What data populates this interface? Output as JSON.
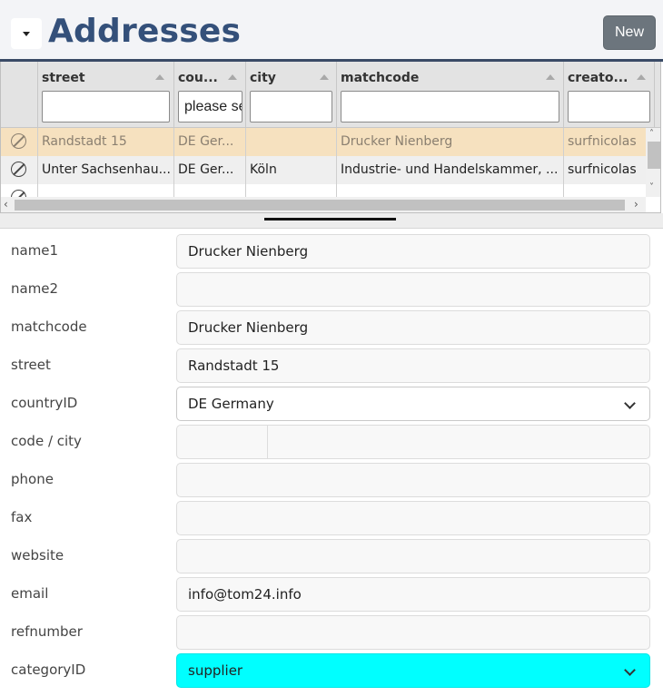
{
  "header": {
    "title": "Addresses",
    "new_label": "New"
  },
  "grid": {
    "columns": [
      {
        "title": "street",
        "filter": ""
      },
      {
        "title": "cou...",
        "filter": "please se"
      },
      {
        "title": "city",
        "filter": ""
      },
      {
        "title": "matchcode",
        "filter": ""
      },
      {
        "title": "creato...",
        "filter": ""
      }
    ],
    "rows": [
      {
        "street": "Randstadt 15",
        "country": "DE Ger...",
        "city": "",
        "matchcode": "Drucker Nienberg",
        "creator": "surfnicolas"
      },
      {
        "street": "Unter Sachsenhau...",
        "country": "DE Ger...",
        "city": "Köln",
        "matchcode": "Industrie- und Handelskammer, ...",
        "creator": "surfnicolas"
      }
    ]
  },
  "form": {
    "fields": [
      {
        "label": "name1",
        "value": "Drucker Nienberg"
      },
      {
        "label": "name2",
        "value": ""
      },
      {
        "label": "matchcode",
        "value": "Drucker Nienberg"
      },
      {
        "label": "street",
        "value": "Randstadt 15"
      },
      {
        "label": "countryID",
        "value": "DE Germany"
      },
      {
        "label": "code / city",
        "value": ""
      },
      {
        "label": "phone",
        "value": ""
      },
      {
        "label": "fax",
        "value": ""
      },
      {
        "label": "website",
        "value": ""
      },
      {
        "label": "email",
        "value": "info@tom24.info"
      },
      {
        "label": "refnumber",
        "value": ""
      },
      {
        "label": "categoryID",
        "value": "supplier"
      }
    ]
  },
  "colors": {
    "title": "#34507a",
    "selected_row": "#f6e1bf",
    "category_highlight": "#00ffff",
    "new_button": "#6c757d"
  }
}
